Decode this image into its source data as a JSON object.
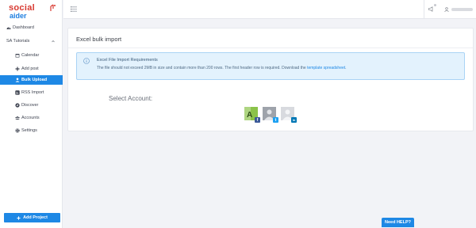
{
  "brand": {
    "logo_top": "social",
    "logo_bottom": "aider",
    "colors": {
      "primary": "#1e88e5",
      "logo_red": "#d8382f"
    }
  },
  "sidebar": {
    "dashboard": {
      "label": "Dashboard",
      "icon": "dashboard-icon"
    },
    "project": {
      "label": "SA Tutorials",
      "icon": "chevron-up-icon"
    },
    "items": [
      {
        "label": "Calendar",
        "icon": "calendar-icon"
      },
      {
        "label": "Add post",
        "icon": "plus-icon"
      },
      {
        "label": "Bulk Upload",
        "icon": "user-upload-icon",
        "active": true
      },
      {
        "label": "RSS Import",
        "icon": "rss-icon"
      },
      {
        "label": "Discover",
        "icon": "compass-icon"
      },
      {
        "label": "Accounts",
        "icon": "users-icon"
      },
      {
        "label": "Settings",
        "icon": "gear-icon"
      }
    ],
    "add_project": "Add Project"
  },
  "topbar": {
    "menu_icon": "hamburger-icon",
    "notif_icon": "megaphone-icon",
    "user_icon": "user-icon"
  },
  "main": {
    "title": "Excel bulk import",
    "alert": {
      "title": "Excel File Import Requirements",
      "text": "The file should not exceed 2MB in size and contain more than 200 rows. The first header row is required. Download the",
      "link": "template spreadsheet",
      "text_end": "."
    },
    "select_account_label": "Select Account:",
    "accounts": [
      {
        "network": "facebook",
        "badge": "f",
        "badge_color": "#3b5998",
        "avatar_letter": "A"
      },
      {
        "network": "twitter",
        "badge": "t",
        "badge_color": "#1da1f2"
      },
      {
        "network": "linkedin",
        "badge": "in",
        "badge_color": "#0077b5"
      }
    ]
  },
  "help_button": "Need HELP?"
}
